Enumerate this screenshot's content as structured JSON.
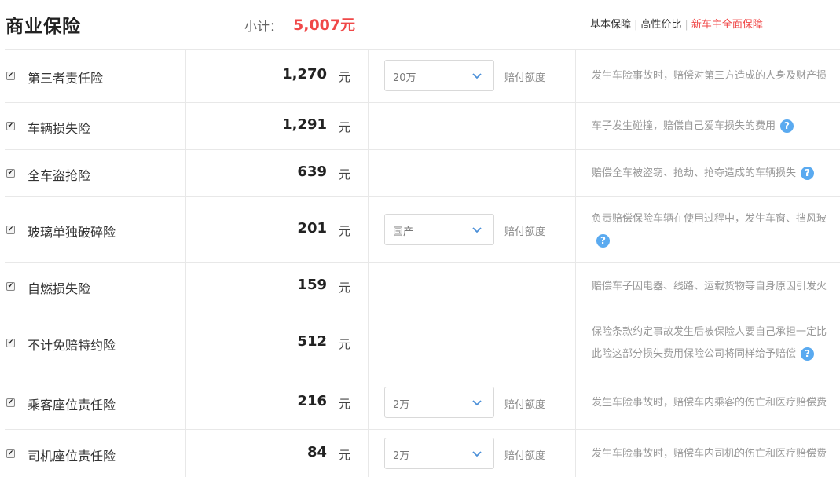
{
  "header": {
    "title": "商业保险",
    "subtotal_label": "小计：",
    "subtotal_value": "5,007元",
    "plans": [
      "基本保障",
      "高性价比",
      "新车主全面保障"
    ]
  },
  "colors": {
    "accent": "#f04848",
    "help": "#5aaaf0",
    "border": "#e8e8e8"
  },
  "rows": [
    {
      "name": "第三者责任险",
      "price": "1,270",
      "unit": "元",
      "checked": true,
      "select": "20万",
      "select_label": "赔付额度",
      "desc": [
        "发生车险事故时，赔偿对第三方造成的人身及财产损"
      ],
      "help": false
    },
    {
      "name": "车辆损失险",
      "price": "1,291",
      "unit": "元",
      "checked": true,
      "desc": [
        "车子发生碰撞，赔偿自己爱车损失的费用"
      ],
      "help": true
    },
    {
      "name": "全车盗抢险",
      "price": "639",
      "unit": "元",
      "checked": true,
      "desc": [
        "赔偿全车被盗窃、抢劫、抢夺造成的车辆损失"
      ],
      "help": true
    },
    {
      "name": "玻璃单独破碎险",
      "price": "201",
      "unit": "元",
      "checked": true,
      "select": "国产",
      "select_label": "赔付额度",
      "desc": [
        "负责赔偿保险车辆在使用过程中，发生车窗、挡风玻",
        ""
      ],
      "help": true
    },
    {
      "name": "自燃损失险",
      "price": "159",
      "unit": "元",
      "checked": true,
      "desc": [
        "赔偿车子因电器、线路、运载货物等自身原因引发火"
      ],
      "help": false
    },
    {
      "name": "不计免赔特约险",
      "price": "512",
      "unit": "元",
      "checked": true,
      "desc": [
        "保险条款约定事故发生后被保险人要自己承担一定比",
        "此险这部分损失费用保险公司将同样给予赔偿"
      ],
      "help": true
    },
    {
      "name": "乘客座位责任险",
      "price": "216",
      "unit": "元",
      "checked": true,
      "select": "2万",
      "select_label": "赔付额度",
      "desc": [
        "发生车险事故时，赔偿车内乘客的伤亡和医疗赔偿费"
      ],
      "help": false
    },
    {
      "name": "司机座位责任险",
      "price": "84",
      "unit": "元",
      "checked": true,
      "select": "2万",
      "select_label": "赔付额度",
      "desc": [
        "发生车险事故时，赔偿车内司机的伤亡和医疗赔偿费"
      ],
      "help": false
    }
  ],
  "icons": {
    "dropdown": "chevron-down-icon",
    "help": "question-icon",
    "check": "checkbox-icon"
  },
  "help_glyph": "?"
}
